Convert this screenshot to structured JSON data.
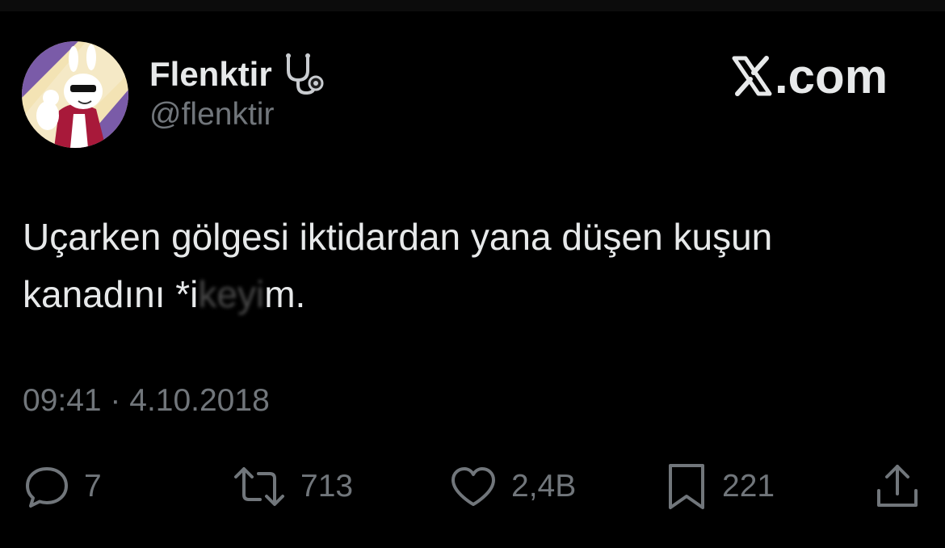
{
  "author": {
    "display_name": "Flenktir",
    "handle": "@flenktir",
    "name_emoji": "stethoscope-icon",
    "avatar": "avatar"
  },
  "brand": {
    "text": ".com",
    "logo": "x-logo-icon"
  },
  "tweet": {
    "text_before": "Uçarken gölgesi iktidardan yana düşen kuşun kanadını *i",
    "text_redacted": "keyi",
    "text_after": "m.",
    "timestamp": "09:41 · 4.10.2018"
  },
  "actions": {
    "reply": {
      "icon": "reply-icon",
      "count": "7"
    },
    "repost": {
      "icon": "repost-icon",
      "count": "713"
    },
    "like": {
      "icon": "heart-icon",
      "count": "2,4B"
    },
    "bookmark": {
      "icon": "bookmark-icon",
      "count": "221"
    },
    "share": {
      "icon": "share-icon"
    }
  },
  "colors": {
    "background": "#000000",
    "primary_text": "#e7e9ea",
    "secondary_text": "#71767b"
  }
}
